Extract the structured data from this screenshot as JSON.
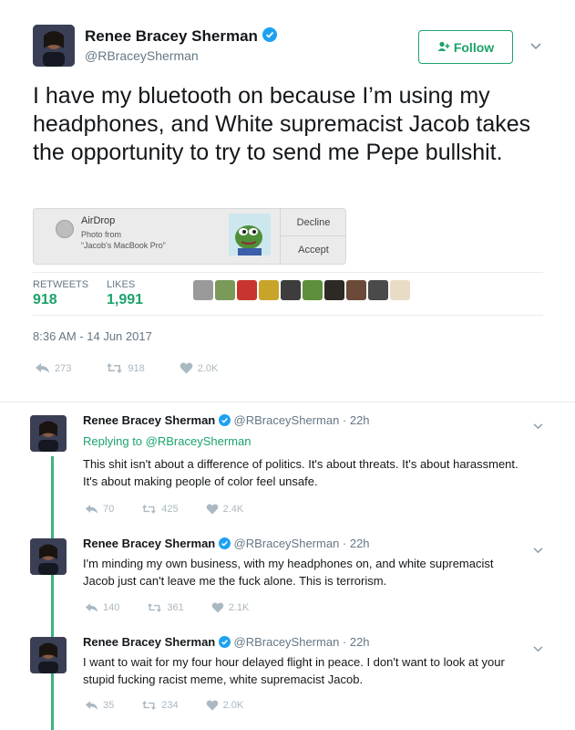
{
  "main_tweet": {
    "author_name": "Renee Bracey Sherman",
    "handle": "@RBraceySherman",
    "follow_label": "Follow",
    "text": "I have my bluetooth on because I’m using my headphones, and White supremacist Jacob takes the opportunity to try to send me Pepe bullshit.",
    "airdrop": {
      "title": "AirDrop",
      "line1": "Photo from",
      "line2": "“Jacob's MacBook Pro”",
      "decline_label": "Decline",
      "accept_label": "Accept"
    },
    "stats": {
      "retweets_label": "RETWEETS",
      "retweets_value": "918",
      "likes_label": "LIKES",
      "likes_value": "1,991"
    },
    "timestamp": "8:36 AM - 14 Jun 2017",
    "actions": {
      "replies": "273",
      "retweets": "918",
      "likes": "2.0K"
    }
  },
  "replies": [
    {
      "author_name": "Renee Bracey Sherman",
      "meta": "@RBraceySherman · 22h",
      "replying_to": "Replying to @RBraceySherman",
      "text": "This shit isn't about a difference of politics. It's about threats. It's about harassment. It's about making people of color feel unsafe.",
      "replies": "70",
      "retweets": "425",
      "likes": "2.4K"
    },
    {
      "author_name": "Renee Bracey Sherman",
      "meta": "@RBraceySherman · 22h",
      "text": "I'm minding my own business, with my headphones on, and white supremacist Jacob just can't leave me the fuck alone. This is terrorism.",
      "replies": "140",
      "retweets": "361",
      "likes": "2.1K"
    },
    {
      "author_name": "Renee Bracey Sherman",
      "meta": "@RBraceySherman · 22h",
      "text": "I want to wait for my four hour delayed flight in peace. I don't want to look at your stupid fucking racist meme, white supremacist Jacob.",
      "replies": "35",
      "retweets": "234",
      "likes": "2.0K"
    }
  ],
  "colors": {
    "accent_green": "#1ca36b",
    "verified_blue": "#1da1f2",
    "muted": "#657786"
  },
  "icons": [
    "verified-icon",
    "follow-person-icon",
    "chevron-down-icon",
    "reply-icon",
    "retweet-icon",
    "heart-icon",
    "airdrop-icon"
  ]
}
